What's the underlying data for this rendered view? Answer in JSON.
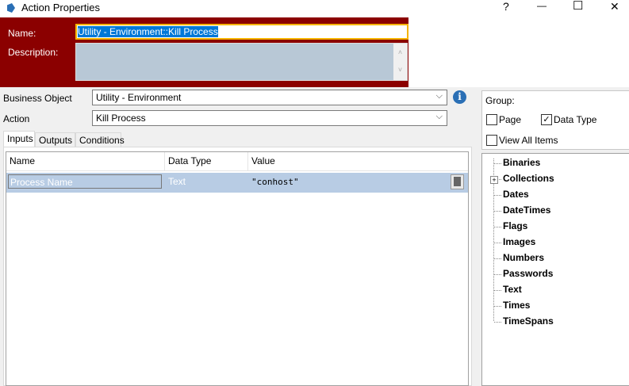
{
  "window": {
    "title": "Action Properties",
    "help": "?",
    "minimize": "—",
    "maximize": "☐",
    "close": "✕"
  },
  "name": {
    "label": "Name:",
    "value": "Utility - Environment::Kill Process"
  },
  "description": {
    "label": "Description:",
    "value": ""
  },
  "business_object": {
    "label": "Business Object",
    "value": "Utility - Environment"
  },
  "action": {
    "label": "Action",
    "value": "Kill Process"
  },
  "tabs": [
    "Inputs",
    "Outputs",
    "Conditions"
  ],
  "grid": {
    "headers": [
      "Name",
      "Data Type",
      "Value"
    ],
    "rows": [
      {
        "name": "Process Name",
        "type": "Text",
        "value": "\"conhost\""
      }
    ]
  },
  "group": {
    "label": "Group:",
    "page": "Page",
    "page_checked": false,
    "data_type": "Data Type",
    "data_type_checked": true,
    "view_all": "View All Items",
    "view_all_checked": false
  },
  "tree": [
    "Binaries",
    "Collections",
    "Dates",
    "DateTimes",
    "Flags",
    "Images",
    "Numbers",
    "Passwords",
    "Text",
    "Times",
    "TimeSpans"
  ],
  "colors": {
    "banner": "#8b0000",
    "focus": "#f5b400",
    "selection": "#b8cce4"
  }
}
